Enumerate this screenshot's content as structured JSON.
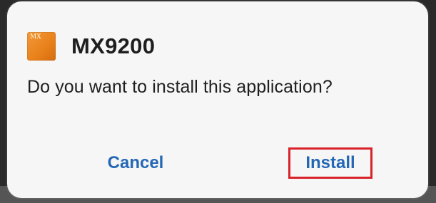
{
  "dialog": {
    "app_icon": {
      "name": "mx-app-icon",
      "text": "MX",
      "color": "#EE8A24"
    },
    "app_name": "MX9200",
    "message": "Do you want to install this application?",
    "buttons": {
      "cancel_label": "Cancel",
      "install_label": "Install"
    },
    "accent_color": "#2467B5",
    "highlight_color": "#D9232A"
  }
}
